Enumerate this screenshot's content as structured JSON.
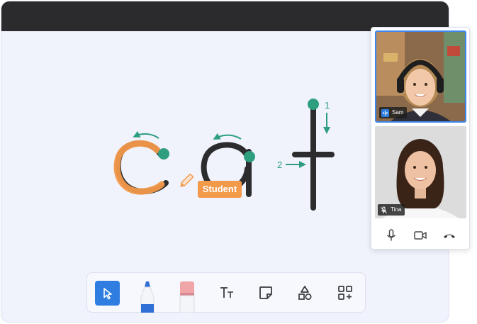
{
  "canvas": {
    "letters": [
      "c",
      "a",
      "t"
    ],
    "stroke_numbers": [
      "1",
      "2"
    ],
    "student_label": "Student"
  },
  "colors": {
    "guide_green": "#2e9e7f",
    "student_orange": "#f2994a",
    "ink": "#2c2c2e",
    "accent_blue": "#2f7de1"
  },
  "toolbar": {
    "tools": [
      {
        "name": "select",
        "icon": "cursor-arrow-icon",
        "active": true
      },
      {
        "name": "pen",
        "icon": "blue-marker-icon"
      },
      {
        "name": "eraser",
        "icon": "eraser-icon"
      },
      {
        "name": "text",
        "icon": "text-size-icon"
      },
      {
        "name": "sticky-note",
        "icon": "sticky-note-icon"
      },
      {
        "name": "shapes",
        "icon": "shapes-icon"
      },
      {
        "name": "more-apps",
        "icon": "add-apps-icon"
      }
    ]
  },
  "video": {
    "participants": [
      {
        "name": "Sam",
        "mic": "speaking",
        "mic_icon": "audio-wave-icon"
      },
      {
        "name": "Tina",
        "mic": "muted",
        "mic_icon": "mic-muted-icon"
      }
    ],
    "controls": [
      {
        "name": "microphone",
        "icon": "microphone-icon"
      },
      {
        "name": "camera",
        "icon": "video-camera-icon"
      },
      {
        "name": "hang-up",
        "icon": "phone-hangup-icon"
      }
    ]
  }
}
